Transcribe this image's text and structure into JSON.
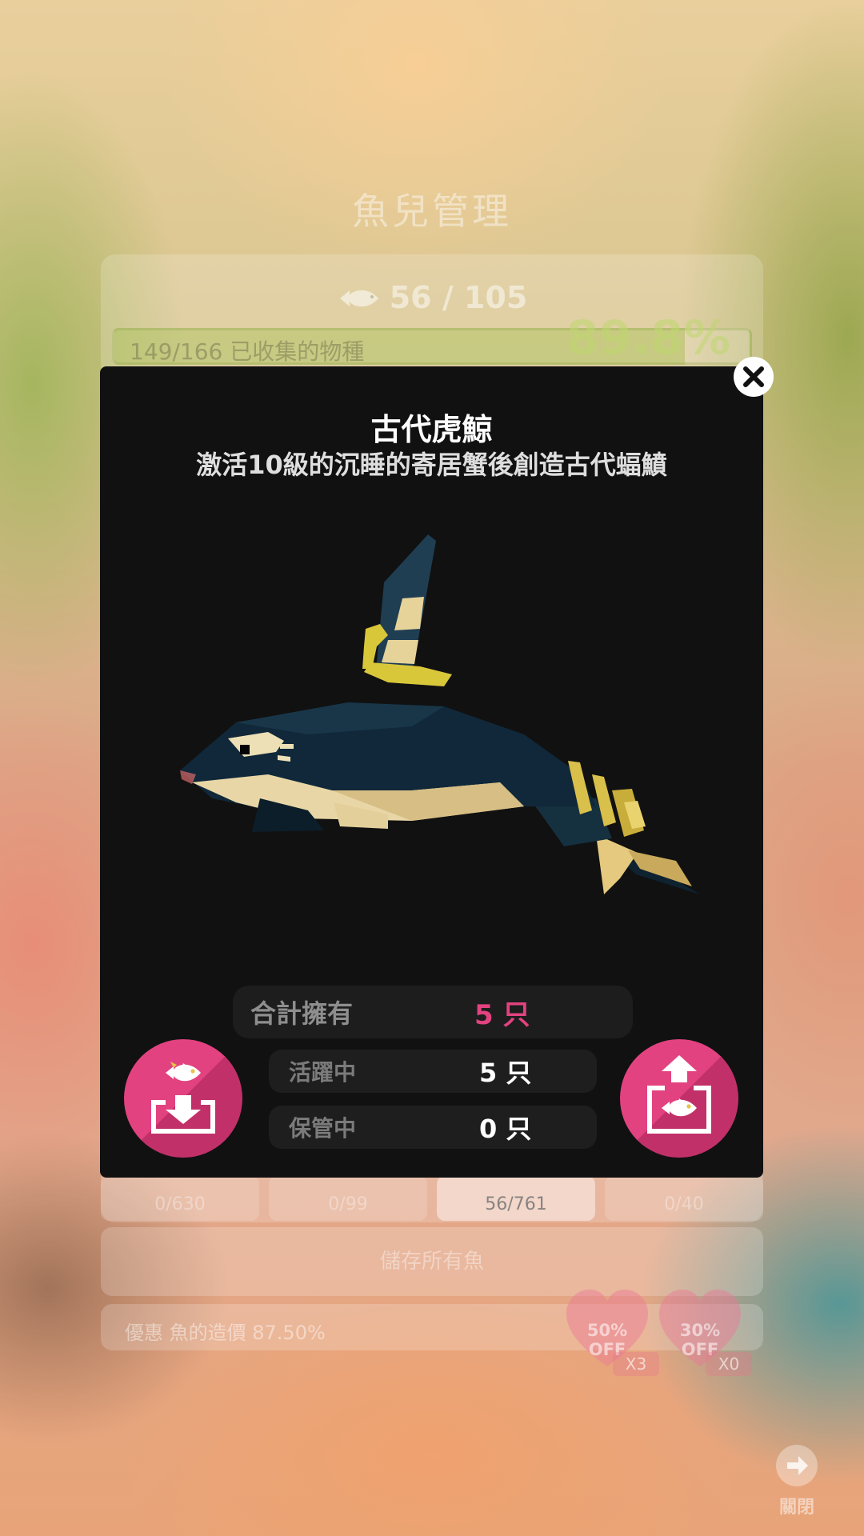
{
  "background": {
    "title": "魚兒管理",
    "fish_count": "56 / 105",
    "collection": {
      "text": "149/166 已收集的物種",
      "percent": "89.8%",
      "progress": 0.898
    },
    "tabs": [
      {
        "label": "0/630",
        "active": false
      },
      {
        "label": "0/99",
        "active": false
      },
      {
        "label": "56/761",
        "active": true
      },
      {
        "label": "0/40",
        "active": false
      }
    ],
    "save_all_label": "儲存所有魚",
    "discount_text": "優惠 魚的造價 87.50%",
    "coupons": [
      {
        "percent": "50%",
        "off": "OFF",
        "count": "X3"
      },
      {
        "percent": "30%",
        "off": "OFF",
        "count": "X0"
      }
    ],
    "close_label": "關閉"
  },
  "modal": {
    "title": "古代虎鯨",
    "subtitle": "激活10級的沉睡的寄居蟹後創造古代蝠鱝",
    "stats": {
      "total_label": "合計擁有",
      "total_value": "5 只",
      "active_label": "活躍中",
      "active_value": "5 只",
      "stored_label": "保管中",
      "stored_value": "0 只"
    },
    "icons": {
      "close": "close-icon",
      "store": "store-fish-icon",
      "release": "release-fish-icon"
    },
    "colors": {
      "accent": "#e24380",
      "total_value": "#e24380",
      "panel": "#111111"
    }
  }
}
